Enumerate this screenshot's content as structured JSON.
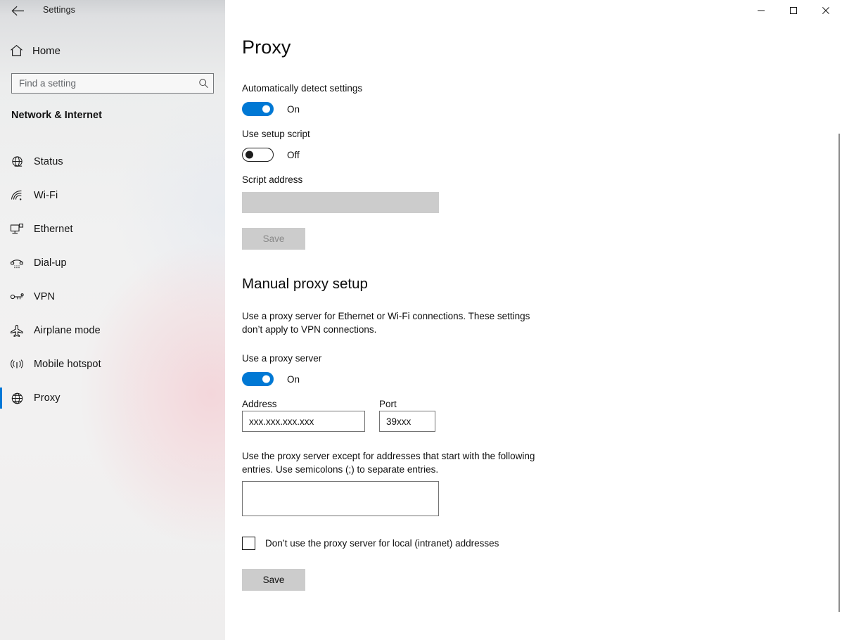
{
  "window": {
    "title": "Settings",
    "back_icon": "back-arrow-icon",
    "minimize_label": "─",
    "maximize_label": "□",
    "close_label": "✕"
  },
  "sidebar": {
    "home": {
      "label": "Home",
      "icon": "home-icon"
    },
    "search": {
      "value": "",
      "placeholder": "Find a setting",
      "icon": "search-icon"
    },
    "category": "Network & Internet",
    "items": [
      {
        "label": "Status",
        "icon": "globe-status-icon",
        "selected": false
      },
      {
        "label": "Wi-Fi",
        "icon": "wifi-icon",
        "selected": false
      },
      {
        "label": "Ethernet",
        "icon": "ethernet-icon",
        "selected": false
      },
      {
        "label": "Dial-up",
        "icon": "dialup-phone-icon",
        "selected": false
      },
      {
        "label": "VPN",
        "icon": "vpn-key-icon",
        "selected": false
      },
      {
        "label": "Airplane mode",
        "icon": "airplane-icon",
        "selected": false
      },
      {
        "label": "Mobile hotspot",
        "icon": "hotspot-icon",
        "selected": false
      },
      {
        "label": "Proxy",
        "icon": "globe-proxy-icon",
        "selected": true
      }
    ]
  },
  "main": {
    "page_title": "Proxy",
    "automatic_setup": {
      "detect_label": "Automatically detect settings",
      "detect_state": "On",
      "script_label": "Use setup script",
      "script_state": "Off",
      "script_address_label": "Script address",
      "script_address_value": "",
      "save_label": "Save"
    },
    "manual_setup": {
      "heading": "Manual proxy setup",
      "description": "Use a proxy server for Ethernet or Wi-Fi connections. These settings don’t apply to VPN connections.",
      "use_proxy_label": "Use a proxy server",
      "use_proxy_state": "On",
      "address_label": "Address",
      "address_value": "xxx.xxx.xxx.xxx",
      "port_label": "Port",
      "port_value": "39xxx",
      "exceptions_description": "Use the proxy server except for addresses that start with the following entries. Use semicolons (;) to separate entries.",
      "exceptions_value": "",
      "bypass_local_label": "Don’t use the proxy server for local (intranet) addresses",
      "bypass_local_checked": false,
      "save_label": "Save"
    }
  },
  "colors": {
    "accent": "#0078d4",
    "selection_bar": "#0078d7",
    "content_bg": "#ffffff",
    "button_bg": "#cccccc",
    "field_border": "#737373"
  }
}
